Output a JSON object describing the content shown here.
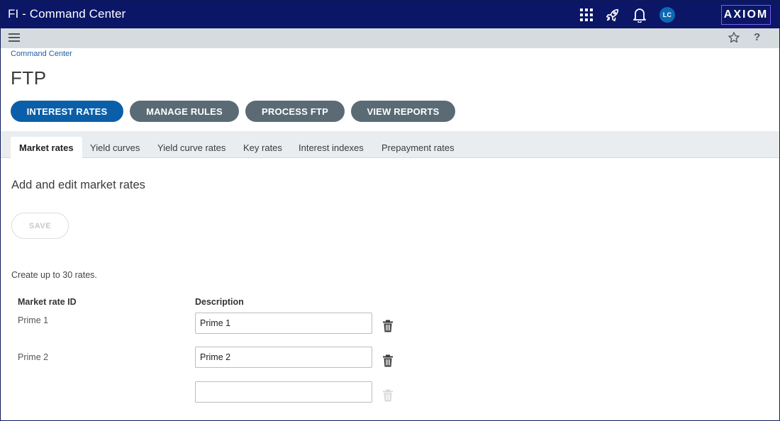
{
  "topbar": {
    "app_title": "FI - Command Center",
    "icons": [
      "apps-grid-icon",
      "rocket-icon",
      "bell-icon"
    ],
    "avatar_initials": "LC",
    "logo_text": "AXIOM",
    "colors": {
      "background": "#0b1766",
      "avatar": "#0e69b3",
      "logo_border": "#7d5cf0"
    }
  },
  "subbar": {
    "menu_icon": "hamburger-icon",
    "favorite_icon": "star-icon",
    "help_label": "?"
  },
  "breadcrumb": "Command Center",
  "page_title": "FTP",
  "action_buttons": [
    {
      "label": "INTEREST RATES",
      "active": true
    },
    {
      "label": "MANAGE RULES",
      "active": false
    },
    {
      "label": "PROCESS FTP",
      "active": false
    },
    {
      "label": "VIEW REPORTS",
      "active": false
    }
  ],
  "tabs": [
    {
      "label": "Market rates",
      "selected": true
    },
    {
      "label": "Yield curves",
      "selected": false
    },
    {
      "label": "Yield curve rates",
      "selected": false
    },
    {
      "label": "Key rates",
      "selected": false
    },
    {
      "label": "Interest indexes",
      "selected": false
    },
    {
      "label": "Prepayment rates",
      "selected": false
    }
  ],
  "content": {
    "heading": "Add and edit market rates",
    "save_label": "SAVE",
    "hint": "Create up to 30 rates.",
    "columns": {
      "id": "Market rate ID",
      "description": "Description"
    },
    "rows": [
      {
        "id": "Prime 1",
        "description": "Prime 1"
      },
      {
        "id": "Prime 2",
        "description": "Prime 2"
      },
      {
        "id": "",
        "description": ""
      }
    ]
  }
}
